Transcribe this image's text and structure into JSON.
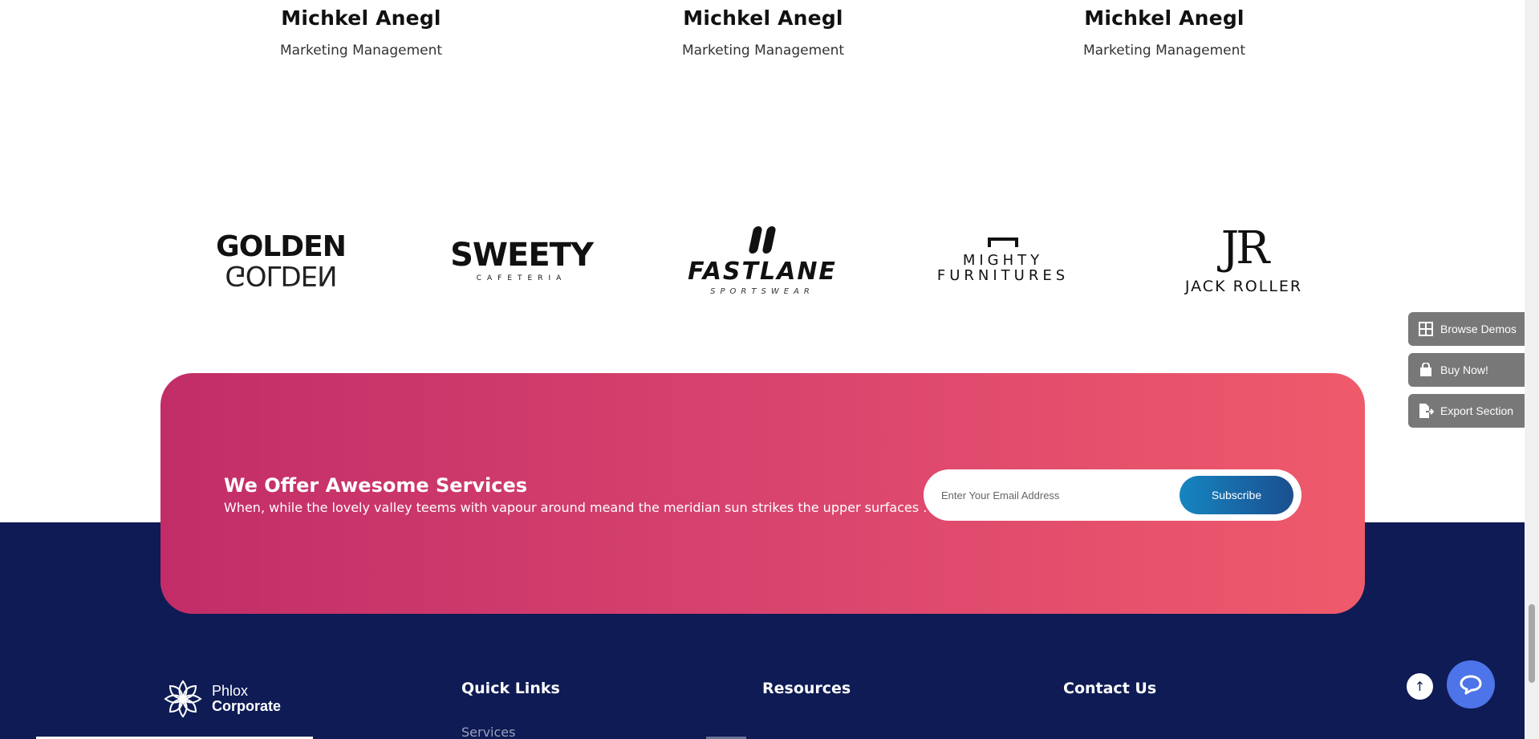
{
  "team": {
    "members": [
      {
        "name": "Michkel Anegl",
        "role": "Marketing Management"
      },
      {
        "name": "Michkel Anegl",
        "role": "Marketing Management"
      },
      {
        "name": "Michkel Anegl",
        "role": "Marketing Management"
      }
    ]
  },
  "logos": {
    "golden": {
      "top": "GOLDEN",
      "mirror": "GOLDEN"
    },
    "sweety": {
      "name": "SWEETY",
      "sub": "CAFETERIA"
    },
    "fastlane": {
      "name": "FASTLANE",
      "sub": "SPORTSWEAR"
    },
    "mighty": {
      "line1": "MIGHTY",
      "line2": "FURNITURES"
    },
    "jackroller": {
      "mark": "JR",
      "name": "JACK ROLLER"
    }
  },
  "newsletter": {
    "title": "We Offer Awesome Services",
    "text": "When, while the lovely valley teems with vapour around meand the meridian sun strikes the upper surfaces .",
    "email_placeholder": "Enter Your Email Address",
    "subscribe_label": "Subscribe"
  },
  "footer": {
    "brand_line1": "Phlox",
    "brand_line2": "Corporate",
    "quick_links_title": "Quick Links",
    "resources_title": "Resources",
    "contact_title": "Contact Us",
    "quick_links": [
      "Services"
    ]
  },
  "side_menu": {
    "browse_demos": "Browse Demos",
    "buy_now": "Buy Now!",
    "export_section": "Export Section"
  },
  "colors": {
    "banner_start": "#c22d68",
    "banner_end": "#ef5a6b",
    "footer_bg": "#0e1b54",
    "subscribe_start": "#1585c0",
    "subscribe_end": "#1b4f8f",
    "chat_button": "#4d74e8",
    "side_button": "#787878"
  },
  "icons": {
    "browse_demos": "grid-icon",
    "buy_now": "shopping-bag-icon",
    "export_section": "export-file-icon",
    "to_top": "arrow-up-icon",
    "chat": "chat-bubble-icon",
    "brand": "flower-logo-icon"
  }
}
